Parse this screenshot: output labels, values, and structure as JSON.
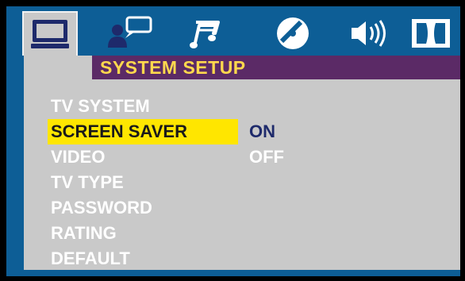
{
  "header": {
    "title": "SYSTEM SETUP"
  },
  "tabs": [
    {
      "icon": "monitor-icon",
      "active": true
    },
    {
      "icon": "person-speech-icon",
      "active": false
    },
    {
      "icon": "music-note-icon",
      "active": false
    },
    {
      "icon": "disc-icon",
      "active": false
    },
    {
      "icon": "speaker-icon",
      "active": false
    },
    {
      "icon": "dolby-icon",
      "active": false
    }
  ],
  "menu": {
    "items": [
      {
        "label": "TV SYSTEM"
      },
      {
        "label": "SCREEN SAVER",
        "selected": true
      },
      {
        "label": "VIDEO"
      },
      {
        "label": "TV TYPE"
      },
      {
        "label": "PASSWORD"
      },
      {
        "label": "RATING"
      },
      {
        "label": "DEFAULT"
      }
    ]
  },
  "options": {
    "items": [
      {
        "label": "ON",
        "selected": true
      },
      {
        "label": "OFF"
      }
    ]
  },
  "colors": {
    "frame": "#0d5e96",
    "panel": "#c9c9c9",
    "header": "#5b2a66",
    "header_text": "#ffd84d",
    "highlight": "#ffe600"
  }
}
